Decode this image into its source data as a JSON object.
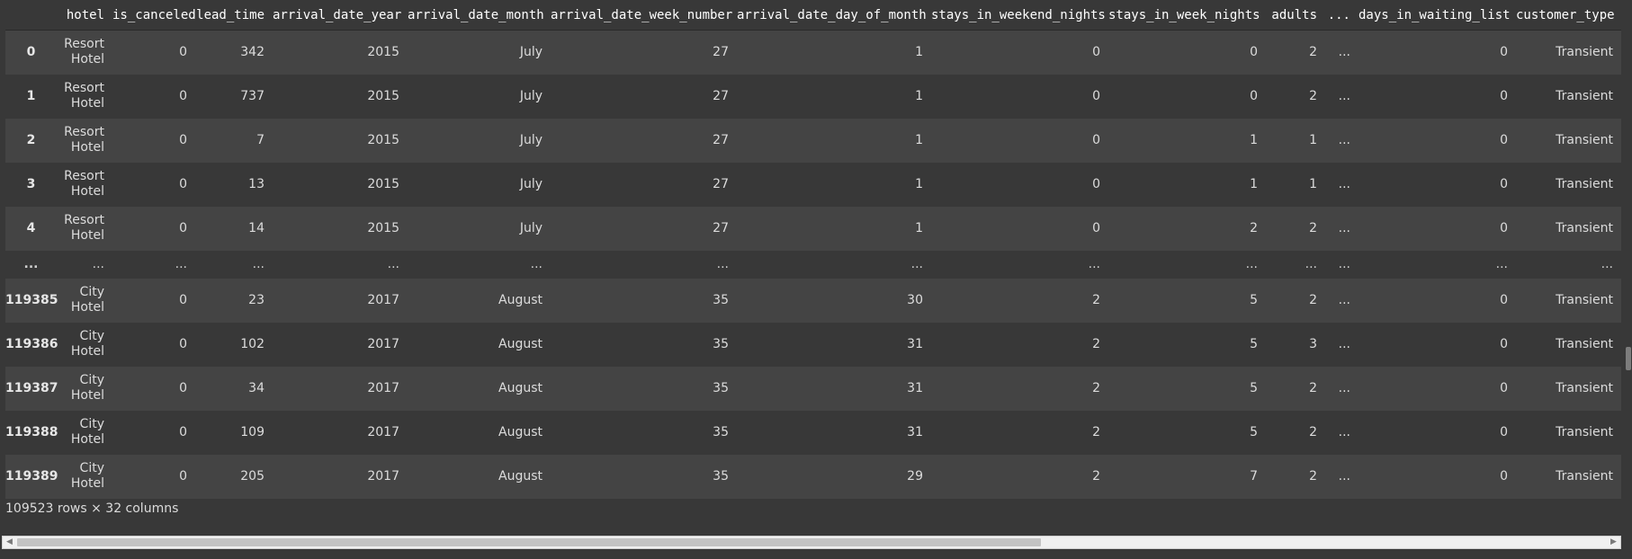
{
  "table": {
    "columns": [
      "",
      "hotel",
      "is_canceled",
      "lead_time",
      "arrival_date_year",
      "arrival_date_month",
      "arrival_date_week_number",
      "arrival_date_day_of_month",
      "stays_in_weekend_nights",
      "stays_in_week_nights",
      "adults",
      "...",
      "days_in_waiting_list",
      "customer_type"
    ],
    "rows": [
      {
        "index": "0",
        "hotel": "Resort Hotel",
        "is_canceled": "0",
        "lead_time": "342",
        "arrival_date_year": "2015",
        "arrival_date_month": "July",
        "arrival_date_week_number": "27",
        "arrival_date_day_of_month": "1",
        "stays_in_weekend_nights": "0",
        "stays_in_week_nights": "0",
        "adults": "2",
        "ellipsis": "...",
        "days_in_waiting_list": "0",
        "customer_type": "Transient"
      },
      {
        "index": "1",
        "hotel": "Resort Hotel",
        "is_canceled": "0",
        "lead_time": "737",
        "arrival_date_year": "2015",
        "arrival_date_month": "July",
        "arrival_date_week_number": "27",
        "arrival_date_day_of_month": "1",
        "stays_in_weekend_nights": "0",
        "stays_in_week_nights": "0",
        "adults": "2",
        "ellipsis": "...",
        "days_in_waiting_list": "0",
        "customer_type": "Transient"
      },
      {
        "index": "2",
        "hotel": "Resort Hotel",
        "is_canceled": "0",
        "lead_time": "7",
        "arrival_date_year": "2015",
        "arrival_date_month": "July",
        "arrival_date_week_number": "27",
        "arrival_date_day_of_month": "1",
        "stays_in_weekend_nights": "0",
        "stays_in_week_nights": "1",
        "adults": "1",
        "ellipsis": "...",
        "days_in_waiting_list": "0",
        "customer_type": "Transient"
      },
      {
        "index": "3",
        "hotel": "Resort Hotel",
        "is_canceled": "0",
        "lead_time": "13",
        "arrival_date_year": "2015",
        "arrival_date_month": "July",
        "arrival_date_week_number": "27",
        "arrival_date_day_of_month": "1",
        "stays_in_weekend_nights": "0",
        "stays_in_week_nights": "1",
        "adults": "1",
        "ellipsis": "...",
        "days_in_waiting_list": "0",
        "customer_type": "Transient"
      },
      {
        "index": "4",
        "hotel": "Resort Hotel",
        "is_canceled": "0",
        "lead_time": "14",
        "arrival_date_year": "2015",
        "arrival_date_month": "July",
        "arrival_date_week_number": "27",
        "arrival_date_day_of_month": "1",
        "stays_in_weekend_nights": "0",
        "stays_in_week_nights": "2",
        "adults": "2",
        "ellipsis": "...",
        "days_in_waiting_list": "0",
        "customer_type": "Transient"
      },
      {
        "index": "...",
        "hotel": "...",
        "is_canceled": "...",
        "lead_time": "...",
        "arrival_date_year": "...",
        "arrival_date_month": "...",
        "arrival_date_week_number": "...",
        "arrival_date_day_of_month": "...",
        "stays_in_weekend_nights": "...",
        "stays_in_week_nights": "...",
        "adults": "...",
        "ellipsis": "...",
        "days_in_waiting_list": "...",
        "customer_type": "..."
      },
      {
        "index": "119385",
        "hotel": "City Hotel",
        "is_canceled": "0",
        "lead_time": "23",
        "arrival_date_year": "2017",
        "arrival_date_month": "August",
        "arrival_date_week_number": "35",
        "arrival_date_day_of_month": "30",
        "stays_in_weekend_nights": "2",
        "stays_in_week_nights": "5",
        "adults": "2",
        "ellipsis": "...",
        "days_in_waiting_list": "0",
        "customer_type": "Transient"
      },
      {
        "index": "119386",
        "hotel": "City Hotel",
        "is_canceled": "0",
        "lead_time": "102",
        "arrival_date_year": "2017",
        "arrival_date_month": "August",
        "arrival_date_week_number": "35",
        "arrival_date_day_of_month": "31",
        "stays_in_weekend_nights": "2",
        "stays_in_week_nights": "5",
        "adults": "3",
        "ellipsis": "...",
        "days_in_waiting_list": "0",
        "customer_type": "Transient"
      },
      {
        "index": "119387",
        "hotel": "City Hotel",
        "is_canceled": "0",
        "lead_time": "34",
        "arrival_date_year": "2017",
        "arrival_date_month": "August",
        "arrival_date_week_number": "35",
        "arrival_date_day_of_month": "31",
        "stays_in_weekend_nights": "2",
        "stays_in_week_nights": "5",
        "adults": "2",
        "ellipsis": "...",
        "days_in_waiting_list": "0",
        "customer_type": "Transient"
      },
      {
        "index": "119388",
        "hotel": "City Hotel",
        "is_canceled": "0",
        "lead_time": "109",
        "arrival_date_year": "2017",
        "arrival_date_month": "August",
        "arrival_date_week_number": "35",
        "arrival_date_day_of_month": "31",
        "stays_in_weekend_nights": "2",
        "stays_in_week_nights": "5",
        "adults": "2",
        "ellipsis": "...",
        "days_in_waiting_list": "0",
        "customer_type": "Transient"
      },
      {
        "index": "119389",
        "hotel": "City Hotel",
        "is_canceled": "0",
        "lead_time": "205",
        "arrival_date_year": "2017",
        "arrival_date_month": "August",
        "arrival_date_week_number": "35",
        "arrival_date_day_of_month": "29",
        "stays_in_weekend_nights": "2",
        "stays_in_week_nights": "7",
        "adults": "2",
        "ellipsis": "...",
        "days_in_waiting_list": "0",
        "customer_type": "Transient"
      }
    ]
  },
  "footer": {
    "shape_text": "109523 rows × 32 columns"
  },
  "scrollbar": {
    "left_arrow_icon": "triangle-left-icon",
    "right_arrow_icon": "triangle-right-icon",
    "horizontal_position": 0.0
  },
  "colors": {
    "background": "#383838",
    "row_alt": "#444444",
    "header_text": "#ffffff",
    "cell_text": "#dcdcdc"
  }
}
